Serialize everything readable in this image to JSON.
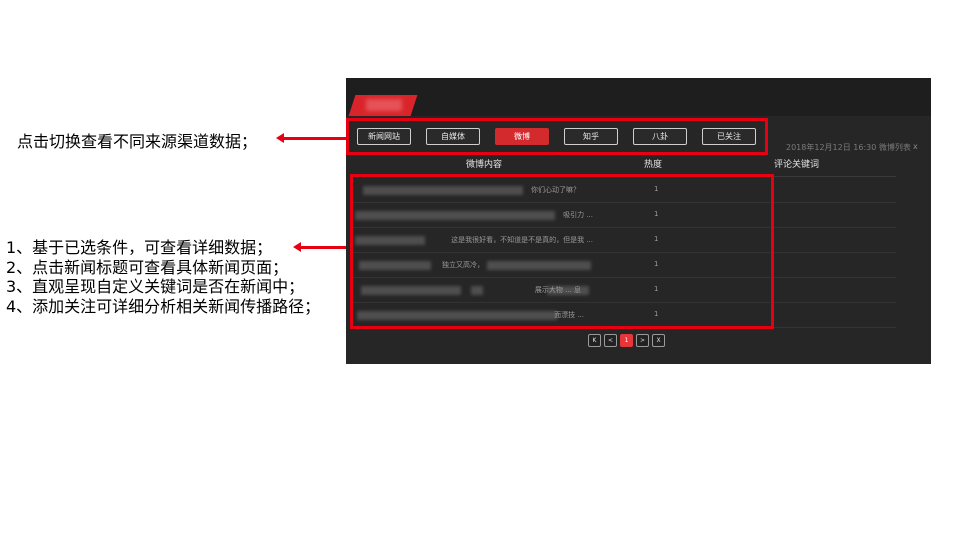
{
  "annotations": {
    "tabs_note": "点击切换查看不同来源渠道数据；",
    "list_notes": [
      "1、基于已选条件，可查看详细数据；",
      "2、点击新闻标题可查看具体新闻页面；",
      "3、直观呈现自定义关键词是否在新闻中；",
      "4、添加关注可详细分析相关新闻传播路径；"
    ]
  },
  "app": {
    "tabs": [
      {
        "label": "新闻网站",
        "active": false
      },
      {
        "label": "自媒体",
        "active": false
      },
      {
        "label": "微博",
        "active": true
      },
      {
        "label": "知乎",
        "active": false
      },
      {
        "label": "八卦",
        "active": false
      },
      {
        "label": "已关注",
        "active": false
      }
    ],
    "meta": {
      "timestamp": "2018年12月12日 16:30 微博列表",
      "close": "x"
    },
    "columns": {
      "content": "微博内容",
      "heat": "热度",
      "keywords": "评论关键词"
    },
    "rows": [
      {
        "title": "你们心动了嘛？",
        "heat": "1"
      },
      {
        "title": "吸引力 ...",
        "heat": "1"
      },
      {
        "title": "这是我很好看，不知道是不是真的，但是我 ...",
        "heat": "1"
      },
      {
        "title": "独立又高冷，",
        "heat": "1"
      },
      {
        "title": "展示大物 ... 息",
        "heat": "1"
      },
      {
        "title": "面漂技 ...",
        "heat": "1"
      }
    ],
    "pager": [
      {
        "label": "K",
        "active": false
      },
      {
        "label": "<",
        "active": false
      },
      {
        "label": "1",
        "active": true
      },
      {
        "label": ">",
        "active": false
      },
      {
        "label": "X",
        "active": false
      }
    ]
  },
  "colors": {
    "accent": "#e60012",
    "panel": "#1b1b1b",
    "active_tab": "#d32a2e"
  }
}
